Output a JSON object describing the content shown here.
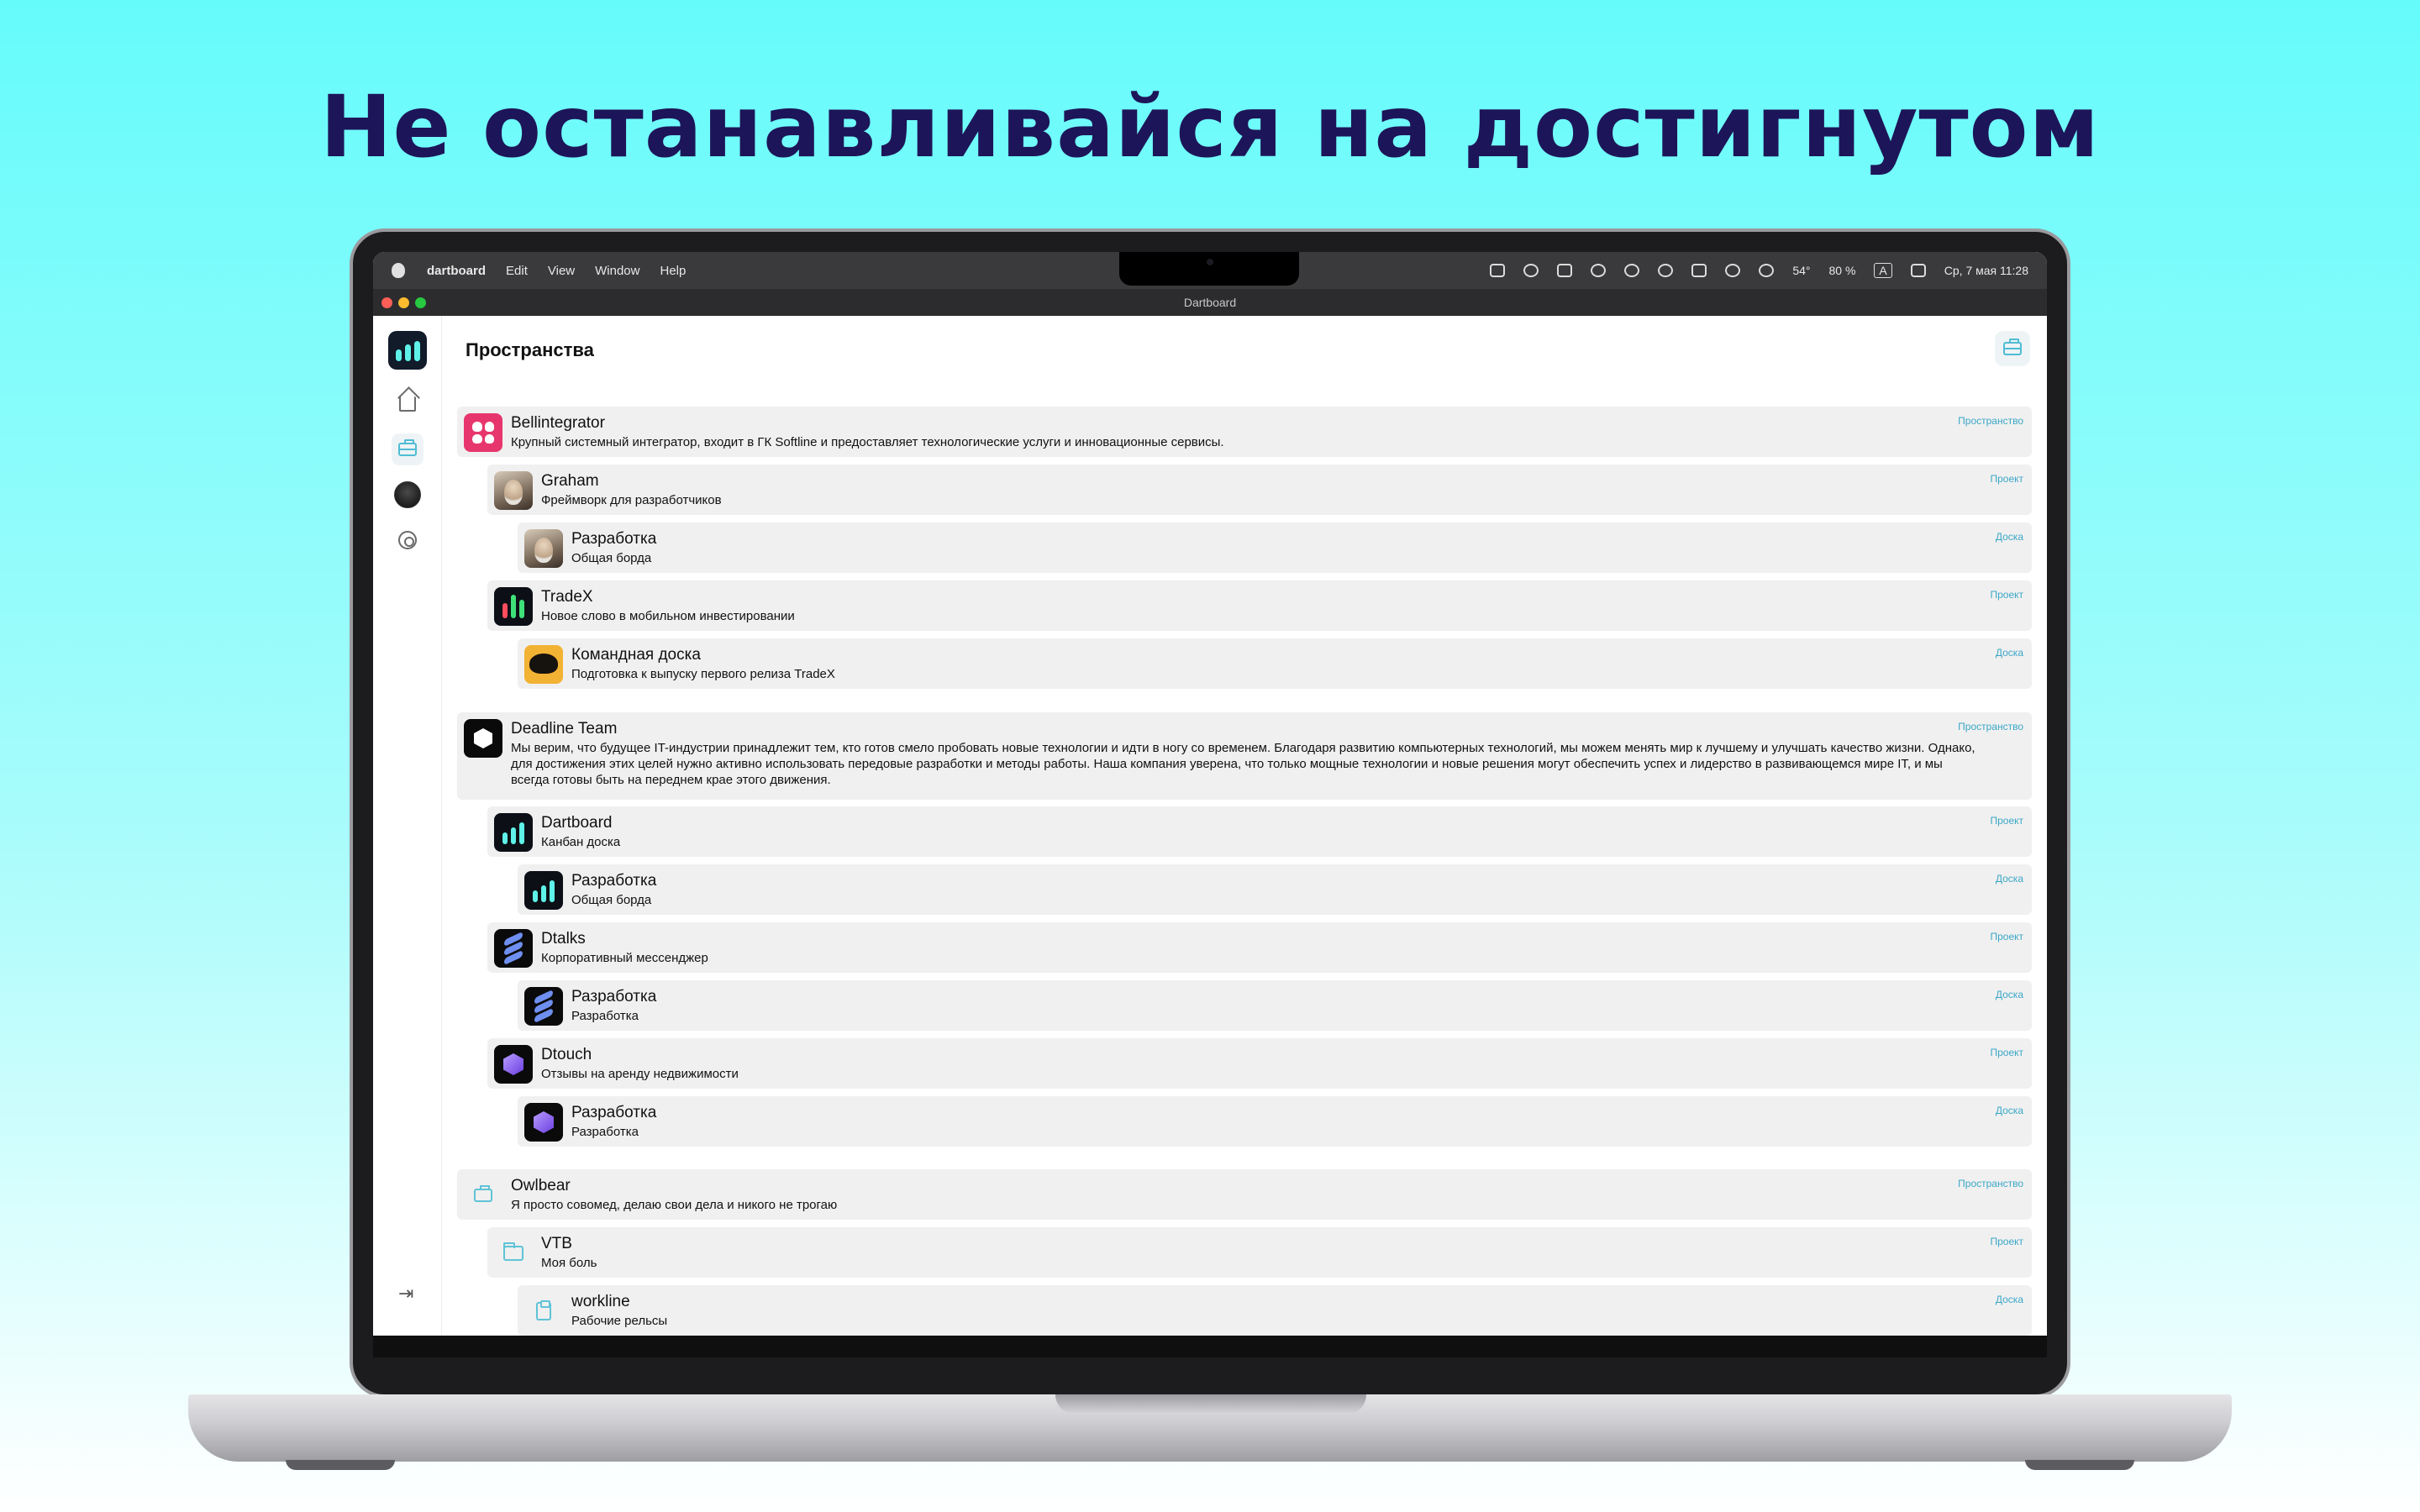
{
  "headline": "Не останавливайся на достигнутом",
  "menubar": {
    "app_name": "dartboard",
    "items": [
      "Edit",
      "View",
      "Window",
      "Help"
    ],
    "temperature": "54°",
    "battery": "80 %",
    "input_lang": "A",
    "datetime": "Ср, 7 мая  11:28"
  },
  "window": {
    "title": "Dartboard"
  },
  "page": {
    "title": "Пространства"
  },
  "rows": [
    {
      "title": "Bellintegrator",
      "desc": "Крупный системный интегратор, входит в ГК Softline и предоставляет технологические услуги и инновационные сервисы.",
      "type": "Пространство",
      "icon": "bellintegrator-logo"
    },
    {
      "title": "Graham",
      "desc": "Фреймворк для разработчиков",
      "type": "Проект",
      "icon": "graham-portrait"
    },
    {
      "title": "Разработка",
      "desc": "Общая борда",
      "type": "Доска",
      "icon": "graham-portrait"
    },
    {
      "title": "TradeX",
      "desc": "Новое слово в мобильном инвестировании",
      "type": "Проект",
      "icon": "tradex-logo"
    },
    {
      "title": "Командная доска",
      "desc": "Подготовка к выпуску первого релиза TradeX",
      "type": "Доска",
      "icon": "owl-logo"
    },
    {
      "title": "Deadline Team",
      "desc": "Мы верим, что будущее IT-индустрии принадлежит тем, кто готов смело пробовать новые технологии и идти в ногу со временем. Благодаря развитию компьютерных технологий, мы можем менять мир к лучшему и улучшать качество жизни. Однако, для достижения этих целей нужно активно использовать передовые разработки и методы работы. Наша компания уверена, что только мощные технологии и новые решения могут обеспечить успех и лидерство в развивающемся мире IT, и мы всегда готовы быть на переднем крае этого движения.",
      "type": "Пространство",
      "icon": "hexagon-logo"
    },
    {
      "title": "Dartboard",
      "desc": "Канбан доска",
      "type": "Проект",
      "icon": "dartboard-logo"
    },
    {
      "title": "Разработка",
      "desc": "Общая борда",
      "type": "Доска",
      "icon": "dartboard-logo"
    },
    {
      "title": "Dtalks",
      "desc": "Корпоративный мессенджер",
      "type": "Проект",
      "icon": "dtalks-logo"
    },
    {
      "title": "Разработка",
      "desc": "Разработка",
      "type": "Доска",
      "icon": "dtalks-logo"
    },
    {
      "title": "Dtouch",
      "desc": "Отзывы на аренду недвижимости",
      "type": "Проект",
      "icon": "dtouch-logo"
    },
    {
      "title": "Разработка",
      "desc": "Разработка",
      "type": "Доска",
      "icon": "dtouch-logo"
    },
    {
      "title": "Owlbear",
      "desc": "Я просто совомед, делаю свои дела и никого не трогаю",
      "type": "Пространство",
      "icon": "briefcase-icon"
    },
    {
      "title": "VTB",
      "desc": "Моя боль",
      "type": "Проект",
      "icon": "folder-icon"
    },
    {
      "title": "workline",
      "desc": "Рабочие рельсы",
      "type": "Доска",
      "icon": "clipboard-icon"
    }
  ],
  "colors": {
    "accent": "#3aa7c6",
    "headline": "#1d1559",
    "background_top": "#66fbfb"
  }
}
